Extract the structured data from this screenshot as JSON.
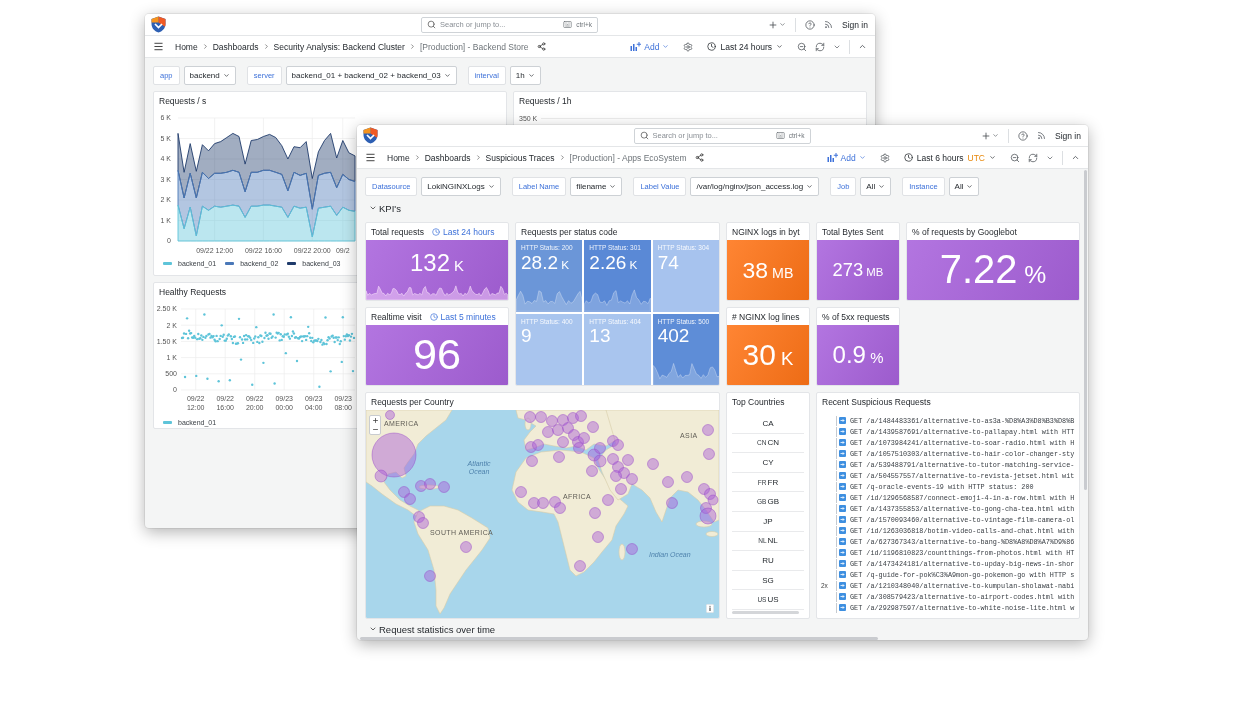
{
  "back_window": {
    "header": {
      "search": {
        "placeholder": "Search or jump to...",
        "shortcut": "ctrl+k"
      },
      "sign_in": "Sign in"
    },
    "breadcrumbs": [
      "Home",
      "Dashboards",
      "Security Analysis: Backend Cluster",
      "[Production] - Backend Store"
    ],
    "toolbar": {
      "add": "Add",
      "time_range": "Last 24 hours"
    },
    "variables": [
      {
        "label": "app",
        "value": "backend"
      },
      {
        "label": "server",
        "value": "backend_01 + backend_02 + backend_03"
      },
      {
        "label": "interval",
        "value": "1h"
      }
    ],
    "panels": [
      {
        "kind": "chart",
        "title": "Requests / s",
        "chart_data": {
          "type": "area",
          "stacked": true,
          "grid": true,
          "categories": [
            null,
            null,
            null,
            null,
            null,
            null,
            "09/22 12:00",
            null,
            null,
            null,
            null,
            null,
            null,
            null,
            "09/22 16:00",
            null,
            null,
            null,
            null,
            null,
            null,
            null,
            "09/22 20:00",
            null,
            null,
            null,
            null,
            "09/2",
            null,
            null
          ],
          "ylim": [
            0,
            6000
          ],
          "yticks": [
            {
              "value": 0,
              "label": "0"
            },
            {
              "value": 1000,
              "label": "1 K"
            },
            {
              "value": 2000,
              "label": "2 K"
            },
            {
              "value": 3000,
              "label": "3 K"
            },
            {
              "value": 4000,
              "label": "4 K"
            },
            {
              "value": 5000,
              "label": "5 K"
            },
            {
              "value": 6000,
              "label": "6 K"
            }
          ],
          "series": [
            {
              "name": "backend_01",
              "color": "#5ec4d9",
              "values": [
                1750,
                600,
                1650,
                250,
                1700,
                1500,
                1700,
                1650,
                1700,
                1750,
                1700,
                1150,
                1700,
                1700,
                1750,
                1750,
                1700,
                1650,
                1150,
                1700,
                1600,
                1650,
                200,
                1600,
                1650,
                1700,
                1250,
                1650,
                1500,
                1450
              ]
            },
            {
              "name": "backend_02",
              "color": "#4a78b8",
              "values": [
                1700,
                1500,
                1650,
                1850,
                1650,
                1550,
                1600,
                1650,
                1650,
                1700,
                1650,
                1250,
                1650,
                1650,
                1700,
                1700,
                1650,
                1600,
                1300,
                1650,
                1600,
                1650,
                1350,
                1600,
                1650,
                1650,
                1350,
                1600,
                1500,
                1450
              ]
            },
            {
              "name": "backend_03",
              "color": "#1f3b6b",
              "values": [
                1800,
                1250,
                1450,
                1300,
                1350,
                1350,
                1450,
                1550,
                1700,
                1800,
                1750,
                1350,
                1550,
                1600,
                1650,
                1750,
                1700,
                1400,
                1550,
                1250,
                1350,
                1550,
                1500,
                1150,
                1600,
                1900,
                1450,
                1650,
                1300,
                1250
              ]
            }
          ]
        }
      },
      {
        "kind": "axis_stub",
        "title": "Requests / 1h",
        "y_tick": "350 K"
      },
      {
        "kind": "scatter_picture",
        "title": "Healthy Requests",
        "y_labels": [
          "2.50 K",
          "2 K",
          "1.50 K",
          "1 K",
          "500",
          "0"
        ],
        "x_labels": [
          "09/22 12:00",
          "09/22 16:00",
          "09/22 20:00",
          "09/23 00:00",
          "09/23 04:00",
          "09/23 08:00"
        ],
        "legend": [
          "backend_01"
        ]
      }
    ]
  },
  "front_window": {
    "header": {
      "search": {
        "placeholder": "Search or jump to...",
        "shortcut": "ctrl+k"
      },
      "sign_in": "Sign in"
    },
    "breadcrumbs": [
      "Home",
      "Dashboards",
      "Suspicious Traces",
      "[Production] - Apps EcoSystem"
    ],
    "toolbar": {
      "add": "Add",
      "time_range": "Last 6 hours",
      "timezone": "UTC"
    },
    "variables": [
      {
        "label": "Datasource",
        "value": "LokiNGINXLogs"
      },
      {
        "label": "Label Name",
        "value": "filename"
      },
      {
        "label": "Label Value",
        "value": "/var/log/nginx/json_access.log"
      },
      {
        "label": "Job",
        "value": "All"
      },
      {
        "label": "Instance",
        "value": "All"
      }
    ],
    "kpi_row": {
      "title": "KPI's",
      "expanded": true
    },
    "panels": [
      {
        "kind": "stat",
        "title": "Total requests",
        "time_info": "Last 24 hours",
        "value": "132",
        "unit": "K",
        "color": "#a862dc",
        "sparkline": true
      },
      {
        "kind": "status_grid",
        "title": "Requests per status code",
        "tiles": [
          {
            "label": "HTTP Status: 200",
            "value": "28.2",
            "unit": "K",
            "color": "#6b96d8",
            "sparkline": true
          },
          {
            "label": "HTTP Status: 301",
            "value": "2.26",
            "unit": "K",
            "color": "#5a89d6",
            "sparkline": true
          },
          {
            "label": "HTTP Status: 304",
            "value": "74",
            "color": "#a7c3ee",
            "sparkline": false
          },
          {
            "label": "HTTP Status: 400",
            "value": "9",
            "color": "#a9c5ee",
            "sparkline": false
          },
          {
            "label": "HTTP Status: 404",
            "value": "13",
            "color": "#a9c5ee",
            "sparkline": false
          },
          {
            "label": "HTTP Status: 500",
            "value": "402",
            "color": "#5e8dd7",
            "sparkline": true
          }
        ]
      },
      {
        "kind": "stat",
        "title": "NGINX logs in byt",
        "value": "38",
        "unit": "MB",
        "color": "#ff7417",
        "sparkline": false
      },
      {
        "kind": "stat",
        "title": "Total Bytes Sent",
        "value": "273",
        "unit": "MB",
        "color": "#a862dc",
        "sparkline": false
      },
      {
        "kind": "stat",
        "title": "% of requests by Googlebot",
        "value": "7.22",
        "unit": "%",
        "color": "#a862dc",
        "sparkline": false
      },
      {
        "kind": "stat",
        "title": "Realtime visit",
        "time_info": "Last 5 minutes",
        "value": "96",
        "color": "#a862dc",
        "sparkline": false
      },
      {
        "kind": "stat",
        "title": "# NGINX log lines",
        "value": "30",
        "unit": "K",
        "color": "#ff7417",
        "sparkline": false
      },
      {
        "kind": "stat",
        "title": "% of 5xx requests",
        "value": "0.9",
        "unit": "%",
        "color": "#a862dc",
        "sparkline": false
      },
      {
        "kind": "map",
        "title": "Requests per Country",
        "labels": [
          {
            "text": "AMERICA",
            "kind": "region"
          },
          {
            "text": "ASIA",
            "kind": "region"
          },
          {
            "text": "Atlantic Ocean",
            "kind": "ocean"
          },
          {
            "text": "AFRICA",
            "kind": "region"
          },
          {
            "text": "SOUTH AMERICA",
            "kind": "region"
          },
          {
            "text": "Indian Ocean",
            "kind": "ocean"
          }
        ]
      },
      {
        "kind": "country_list",
        "title": "Top Countries",
        "countries": [
          {
            "code": "CA"
          },
          {
            "flag": "CN",
            "code": "CN"
          },
          {
            "code": "CY"
          },
          {
            "flag": "FR",
            "code": "FR"
          },
          {
            "flag": "GB",
            "code": "GB"
          },
          {
            "code": "JP"
          },
          {
            "flag": "NL",
            "code": "NL"
          },
          {
            "code": "RU"
          },
          {
            "code": "SG"
          },
          {
            "flag": "US",
            "code": "US"
          }
        ]
      },
      {
        "kind": "logs",
        "title": "Recent Suspicious Requests",
        "lines": [
          {
            "text": "GET /a/1484483361/alternative-to-as3a-%D8%A3%D8%B3%D8%B"
          },
          {
            "text": "GET /a/1439587691/alternative-to-pallapay.html with HTT"
          },
          {
            "text": "GET /a/1073984241/alternative-to-soar-radio.html with H"
          },
          {
            "text": "GET /a/1057510303/alternative-to-hair-color-changer-sty"
          },
          {
            "text": "GET /a/539488791/alternative-to-tutor-matching-service-"
          },
          {
            "text": "GET /a/504557557/alternative-to-revista-jetset.html wit"
          },
          {
            "text": "GET /q-oracle-events-19 with HTTP status: 200"
          },
          {
            "text": "GET /id/1296568587/connect-emoji-4-in-a-row.html with H"
          },
          {
            "text": "GET /a/1437355853/alternative-to-gong-cha-tea.html with"
          },
          {
            "text": "GET /a/1570093460/alternative-to-vintage-film-camera-ol"
          },
          {
            "text": "GET /id/1263036818/botim-video-calls-and-chat.html with"
          },
          {
            "text": "GET /a/627367343/alternative-to-bang-%D8%A8%D8%A7%D9%86"
          },
          {
            "text": "GET /id/1196810823/countthings-from-photos.html with HT"
          },
          {
            "text": "GET /a/1473424181/alternative-to-upday-big-news-in-shor"
          },
          {
            "text": "GET /q-guide-for-pok%C3%A9mon-go-pokemon-go with HTTP s"
          },
          {
            "count": "2x",
            "text": "GET /a/1210348040/alternative-to-kumpulan-sholawat-nabi"
          },
          {
            "text": "GET /a/308579423/alternative-to-airport-codes.html with"
          },
          {
            "text": "GET /a/292987597/alternative-to-white-noise-lite.html w"
          }
        ]
      }
    ],
    "next_row": {
      "title": "Request statistics over time",
      "expanded": true
    }
  }
}
